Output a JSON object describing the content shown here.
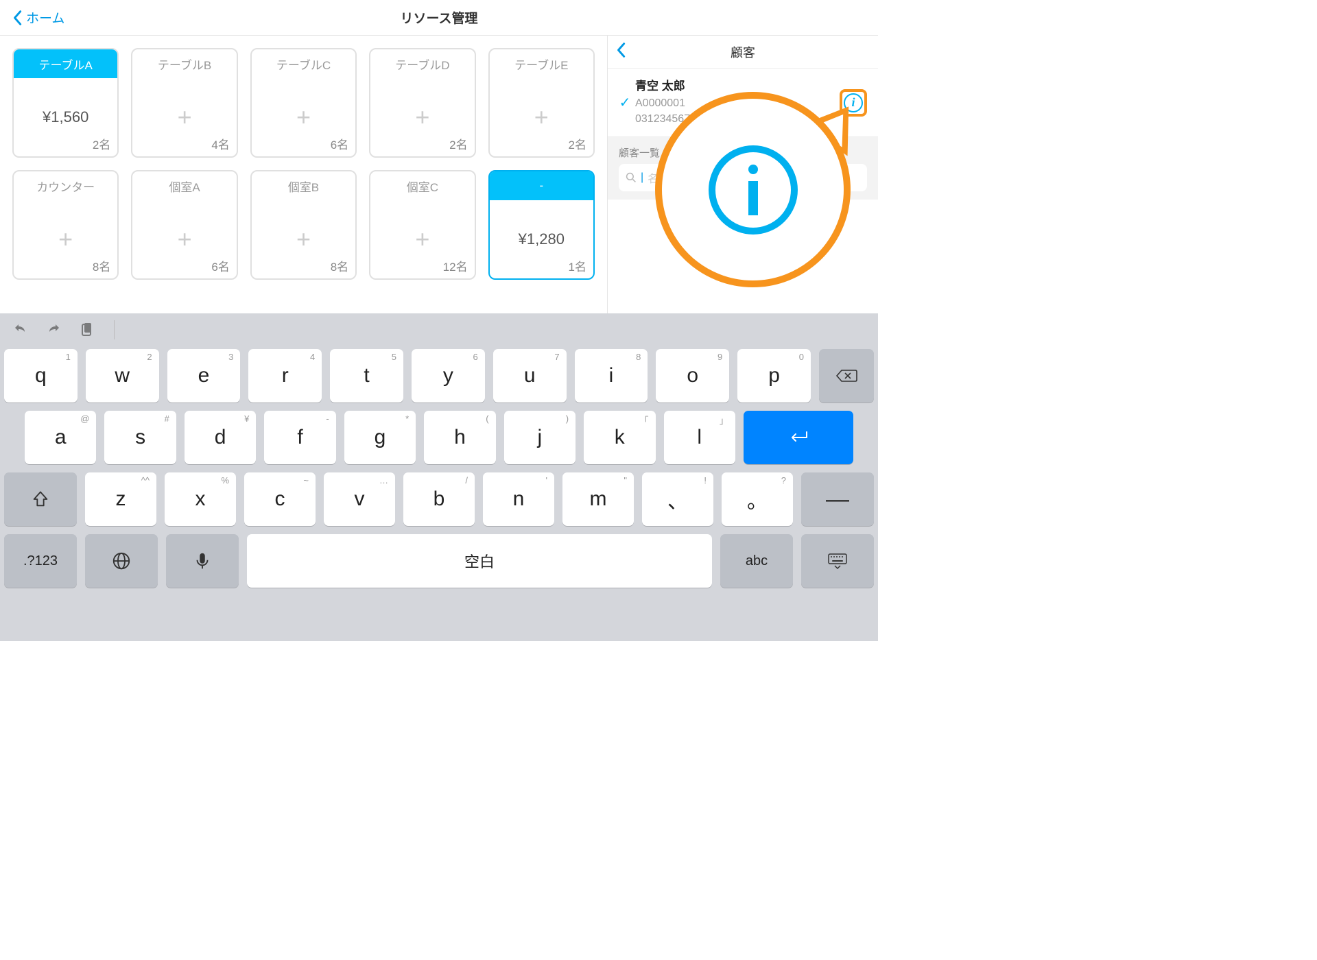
{
  "nav": {
    "back": "ホーム",
    "title": "リソース管理"
  },
  "tables": [
    {
      "name": "テーブルA",
      "price": "¥1,560",
      "seats": "2名",
      "active": true,
      "selected": false
    },
    {
      "name": "テーブルB",
      "price": "",
      "seats": "4名",
      "active": false,
      "selected": false
    },
    {
      "name": "テーブルC",
      "price": "",
      "seats": "6名",
      "active": false,
      "selected": false
    },
    {
      "name": "テーブルD",
      "price": "",
      "seats": "2名",
      "active": false,
      "selected": false
    },
    {
      "name": "テーブルE",
      "price": "",
      "seats": "2名",
      "active": false,
      "selected": false
    },
    {
      "name": "カウンター",
      "price": "",
      "seats": "8名",
      "active": false,
      "selected": false
    },
    {
      "name": "個室A",
      "price": "",
      "seats": "6名",
      "active": false,
      "selected": false
    },
    {
      "name": "個室B",
      "price": "",
      "seats": "8名",
      "active": false,
      "selected": false
    },
    {
      "name": "個室C",
      "price": "",
      "seats": "12名",
      "active": false,
      "selected": false
    },
    {
      "name": "-",
      "price": "¥1,280",
      "seats": "1名",
      "active": true,
      "selected": true
    }
  ],
  "panel": {
    "title": "顧客",
    "customer": {
      "name": "青空 太郎",
      "code": "A0000001",
      "phone": "0312345678"
    },
    "list_header": "顧客一覧",
    "search_placeholder": "名前/顧客コード/電話番号を入力"
  },
  "keyboard": {
    "row1": [
      {
        "main": "q",
        "hint": "1"
      },
      {
        "main": "w",
        "hint": "2"
      },
      {
        "main": "e",
        "hint": "3"
      },
      {
        "main": "r",
        "hint": "4"
      },
      {
        "main": "t",
        "hint": "5"
      },
      {
        "main": "y",
        "hint": "6"
      },
      {
        "main": "u",
        "hint": "7"
      },
      {
        "main": "i",
        "hint": "8"
      },
      {
        "main": "o",
        "hint": "9"
      },
      {
        "main": "p",
        "hint": "0"
      }
    ],
    "row2": [
      {
        "main": "a",
        "hint": "@"
      },
      {
        "main": "s",
        "hint": "#"
      },
      {
        "main": "d",
        "hint": "¥"
      },
      {
        "main": "f",
        "hint": "-"
      },
      {
        "main": "g",
        "hint": "*"
      },
      {
        "main": "h",
        "hint": "("
      },
      {
        "main": "j",
        "hint": ")"
      },
      {
        "main": "k",
        "hint": "「"
      },
      {
        "main": "l",
        "hint": "」"
      }
    ],
    "row3": [
      {
        "main": "z",
        "hint": "^^"
      },
      {
        "main": "x",
        "hint": "%"
      },
      {
        "main": "c",
        "hint": "~"
      },
      {
        "main": "v",
        "hint": "…"
      },
      {
        "main": "b",
        "hint": "/"
      },
      {
        "main": "n",
        "hint": "'"
      },
      {
        "main": "m",
        "hint": "\""
      },
      {
        "main": "、",
        "hint": "!"
      },
      {
        "main": "。",
        "hint": "?"
      }
    ],
    "mode": ".?123",
    "abc": "abc",
    "space": "空白"
  }
}
